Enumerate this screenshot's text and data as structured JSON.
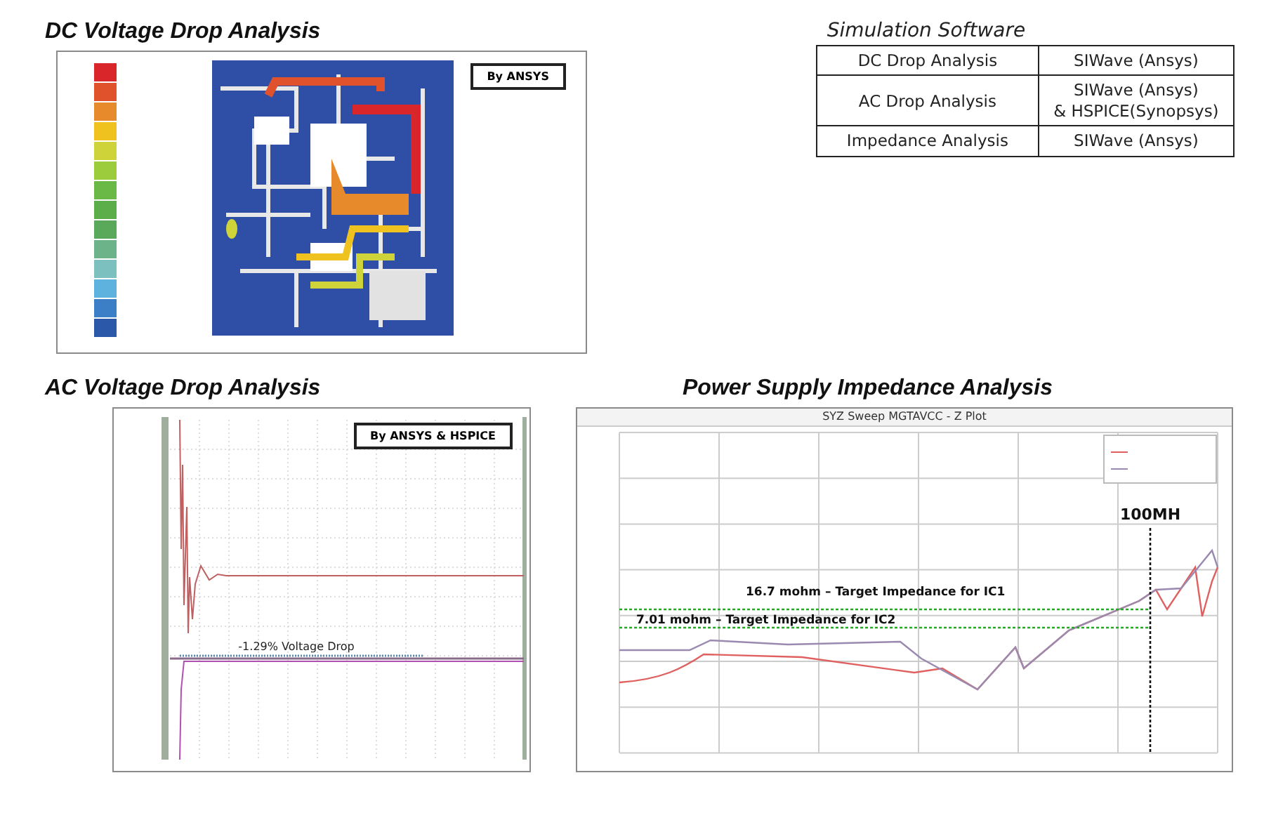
{
  "dc_panel": {
    "title": "DC Voltage Drop Analysis",
    "badge": "By ANSYS"
  },
  "software_table": {
    "title": "Simulation Software",
    "rows": [
      {
        "analysis": "DC Drop Analysis",
        "software": [
          "SIWave (Ansys)"
        ]
      },
      {
        "analysis": "AC Drop Analysis",
        "software": [
          "SIWave (Ansys)",
          "& HSPICE(Synopsys)"
        ]
      },
      {
        "analysis": "Impedance Analysis",
        "software": [
          "SIWave (Ansys)"
        ]
      }
    ]
  },
  "ac_panel": {
    "title": "AC Voltage Drop Analysis",
    "badge": "By ANSYS & HSPICE",
    "annotation": "-1.29% Voltage Drop"
  },
  "impedance_panel": {
    "title": "Power Supply Impedance Analysis",
    "plot_title": "SYZ Sweep MGTAVCC - Z Plot",
    "marker": "100MH",
    "targets": [
      "16.7 mohm – Target Impedance for IC1",
      "7.01 mohm – Target Impedance for IC2"
    ]
  }
}
